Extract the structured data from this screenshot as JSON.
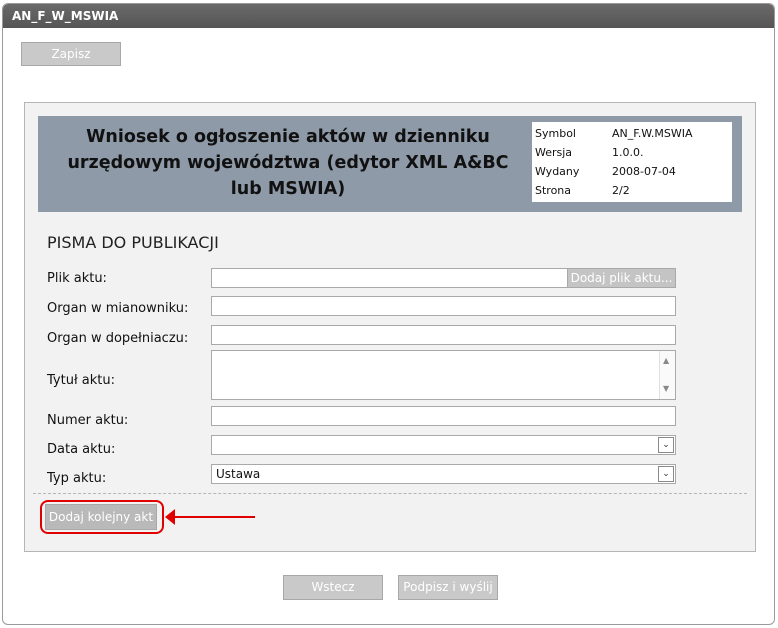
{
  "window": {
    "title": "AN_F_W_MSWIA"
  },
  "toolbar": {
    "save_label": "Zapisz"
  },
  "header": {
    "title": "Wniosek o ogłoszenie aktów w dzienniku urzędowym województwa (edytor XML A&BC lub MSWIA)",
    "meta": [
      {
        "key": "Symbol",
        "value": "AN_F.W.MSWIA"
      },
      {
        "key": "Wersja",
        "value": "1.0.0."
      },
      {
        "key": "Wydany",
        "value": "2008-07-04"
      },
      {
        "key": "Strona",
        "value": "2/2"
      }
    ]
  },
  "form": {
    "section_title": "PISMA DO PUBLIKACJI",
    "plik_label": "Plik aktu:",
    "plik_value": "",
    "plik_button": "Dodaj plik aktu...",
    "organ_m_label": "Organ w mianowniku:",
    "organ_m_value": "",
    "organ_d_label": "Organ w dopełniaczu:",
    "organ_d_value": "",
    "tytul_label": "Tytuł aktu:",
    "tytul_value": "",
    "numer_label": "Numer aktu:",
    "numer_value": "",
    "data_label": "Data aktu:",
    "data_value": "",
    "typ_label": "Typ aktu:",
    "typ_value": "Ustawa",
    "add_button": "Dodaj kolejny akt"
  },
  "footer": {
    "back_label": "Wstecz",
    "sign_label": "Podpisz i wyślij"
  },
  "colors": {
    "highlight": "#e00000",
    "header_bg": "#8e9aa8",
    "titlebar": "#5f5f5f"
  }
}
